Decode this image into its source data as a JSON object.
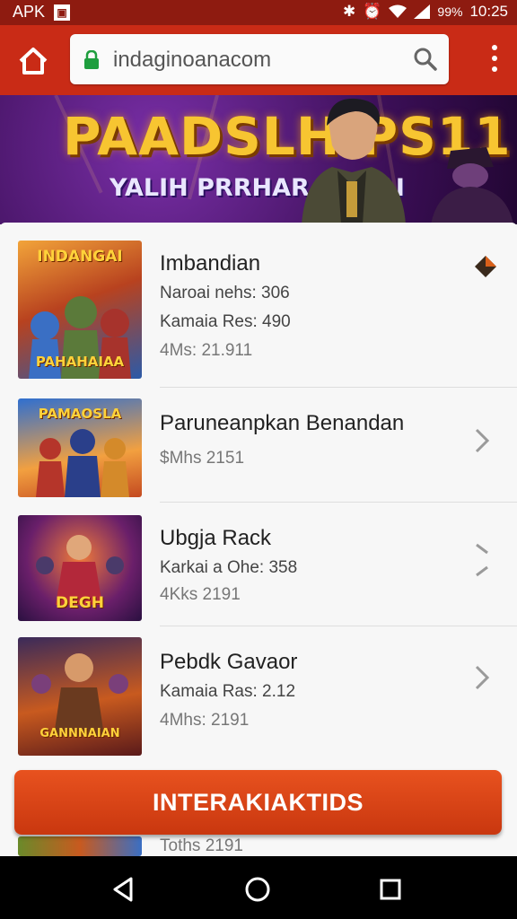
{
  "status_bar": {
    "app_label": "APK",
    "battery": "99%",
    "time": "10:25"
  },
  "browser": {
    "url": "indaginoanacom"
  },
  "banner": {
    "title": "PAADSLH  PS11",
    "subtitle": "YALIH PRRHAR RHDAI"
  },
  "list": {
    "items": [
      {
        "thumb_title": "INDANGAI",
        "thumb_caption": "PAHAHAIAA",
        "title": "Imbandian",
        "meta1": "Naroai nehs: 306",
        "meta2": "Kamaia Res: 490",
        "meta3": "4Ms: 21.911"
      },
      {
        "thumb_title": "PAMAOSLA",
        "title": "Paruneanpkan Benandan",
        "meta1": "$Mhs 2151"
      },
      {
        "thumb_caption": "DEGH",
        "title": "Ubgja Rack",
        "meta1": "Karkai a Ohe: 358",
        "meta2": "4Kks 2191"
      },
      {
        "thumb_caption": "GANNNAIAN",
        "title": "Pebdk Gavaor",
        "meta1": "Kamaia Ras: 2.12",
        "meta2": "4Mhs: 2191"
      }
    ],
    "partial_row_text": "Toths 2191"
  },
  "cta": {
    "label": "INTERAKIAKTIDS"
  },
  "colors": {
    "toolbar": "#c92b16",
    "status_bar": "#8e1b10",
    "cta": "#e04a1a"
  }
}
